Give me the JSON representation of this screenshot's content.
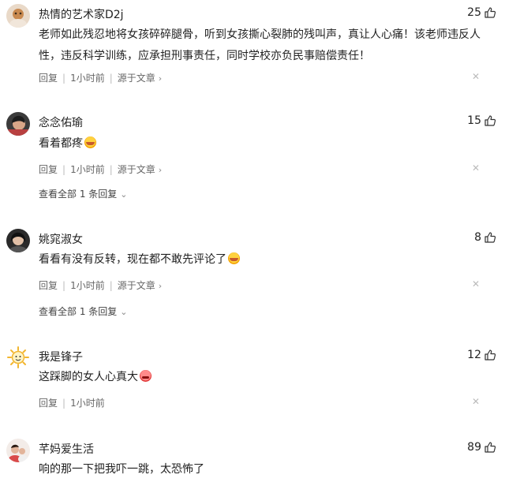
{
  "comments": [
    {
      "username": "热情的艺术家D2j",
      "likes": "25",
      "text": "老师如此残忍地将女孩碎碎腿骨，听到女孩撕心裂肺的残叫声，真让人心痛！该老师违反人性，违反科学训练，应承担刑事责任，同时学校亦负民事赔偿责任！",
      "reply": "回复",
      "time": "1小时前",
      "source": "源于文章"
    },
    {
      "username": "念念佑瑜",
      "likes": "15",
      "text": "看着都疼",
      "reply": "回复",
      "time": "1小时前",
      "source": "源于文章",
      "view_replies": "查看全部 1 条回复"
    },
    {
      "username": "姚窕淑女",
      "likes": "8",
      "text": "看看有没有反转，现在都不敢先评论了",
      "reply": "回复",
      "time": "1小时前",
      "source": "源于文章",
      "view_replies": "查看全部 1 条回复"
    },
    {
      "username": "我是锋子",
      "likes": "12",
      "text": "这踩脚的女人心真大",
      "reply": "回复",
      "time": "1小时前"
    },
    {
      "username": "芊妈爱生活",
      "likes": "89",
      "text": "响的那一下把我吓一跳，太恐怖了"
    }
  ],
  "icons": {
    "like": "thumbs-up-icon",
    "close": "close-icon",
    "chevron_right": "chevron-right-icon",
    "chevron_down": "chevron-down-icon"
  },
  "colors": {
    "text": "#222222",
    "meta": "#666666",
    "muted": "#bbbbbb"
  }
}
